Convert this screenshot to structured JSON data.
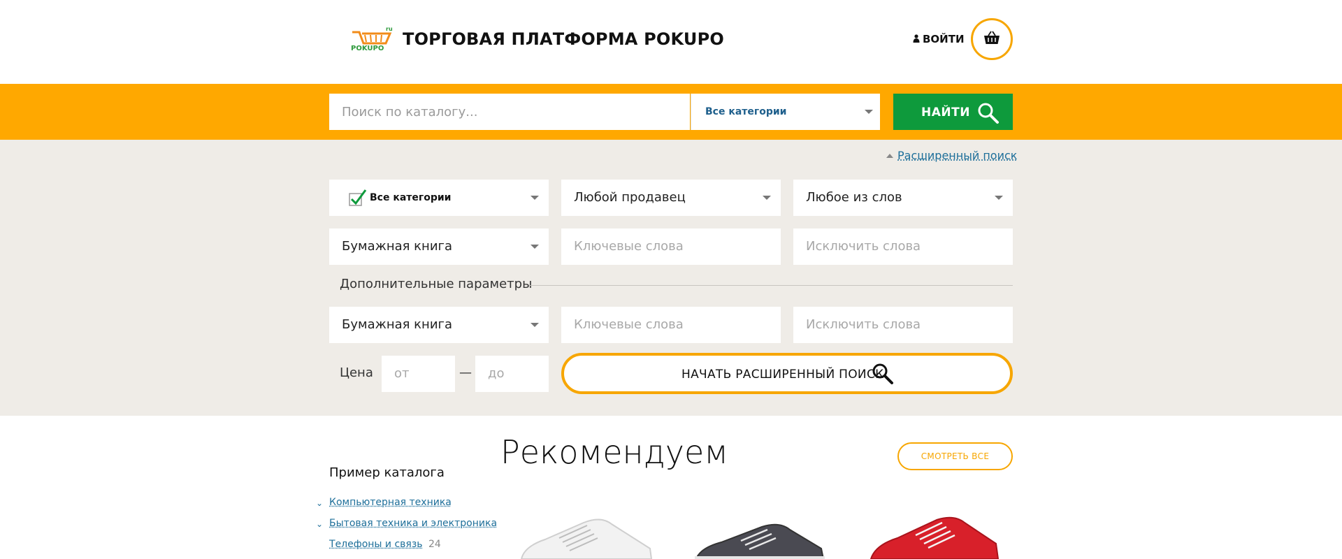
{
  "header": {
    "logo_text": "POKUPO",
    "logo_badge": "ru",
    "title": "ТОРГОВАЯ ПЛАТФОРМА POKUPO",
    "login_label": "ВОЙТИ",
    "cart_icon": "basket-icon",
    "user_icon": "user-icon"
  },
  "search": {
    "placeholder": "Поиск по каталогу...",
    "category_value": "Все категории",
    "find_label": "НАЙТИ",
    "search_icon": "search-icon"
  },
  "advanced": {
    "toggle_label": "Расширенный поиск",
    "row1": {
      "category": "Все категории",
      "seller": "Любой продавец",
      "words_mode": "Любое из слов"
    },
    "row2": {
      "type": "Бумажная книга",
      "keywords_placeholder": "Ключевые слова",
      "exclude_placeholder": "Исключить слова"
    },
    "params_title": "Дополнительные параметры",
    "row3": {
      "type": "Бумажная книга",
      "keywords_placeholder": "Ключевые слова",
      "exclude_placeholder": "Исключить слова"
    },
    "price": {
      "label": "Цена",
      "from_placeholder": "от",
      "dash": "—",
      "to_placeholder": "до"
    },
    "start_label": "НАЧАТЬ РАСШИРЕННЫЙ ПОИСК"
  },
  "catalog": {
    "title": "Пример каталога",
    "items": [
      {
        "label": "Компьютерная техника",
        "expanded": true
      },
      {
        "label": "Бытовая техника и электроника",
        "expanded": true
      },
      {
        "label": "Телефоны и связь",
        "count": "24"
      }
    ]
  },
  "recommend": {
    "title": "Рекомендуем",
    "see_all_label": "СМОТРЕТЬ ВСЕ",
    "products": [
      {
        "name": "white-sneaker",
        "color": "#f2f2f2"
      },
      {
        "name": "gray-sneaker",
        "color": "#4a4a52"
      },
      {
        "name": "red-sneaker",
        "color": "#d8202a"
      }
    ]
  },
  "colors": {
    "accent": "#ffa800",
    "green": "#0e9a3c",
    "link": "#1e6f9a",
    "panel_bg": "#efece7"
  }
}
